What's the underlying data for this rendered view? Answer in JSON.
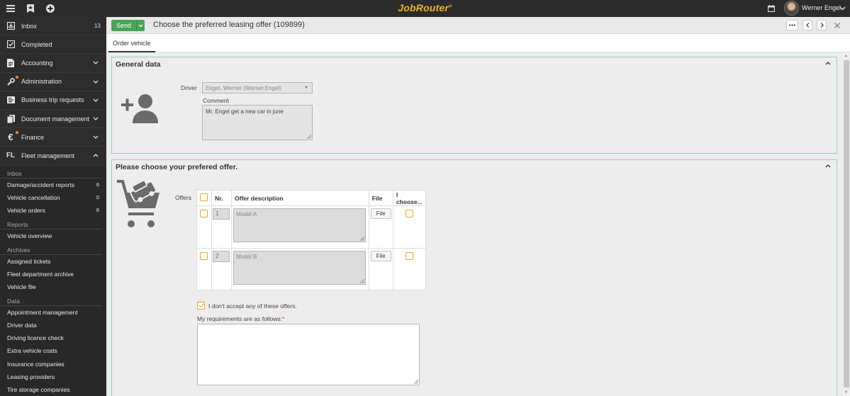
{
  "app": {
    "logo": "JobRouter",
    "logo_mark": "®"
  },
  "topbar": {
    "user_name": "Werner Engel"
  },
  "sidebar": {
    "nav": [
      {
        "label": "Inbox",
        "count": "13",
        "icon": "inbox-icon"
      },
      {
        "label": "Completed",
        "count": "",
        "icon": "check-square-icon"
      },
      {
        "label": "Accounting",
        "icon": "document-icon"
      },
      {
        "label": "Administration",
        "icon": "wrench-icon",
        "notify": true
      },
      {
        "label": "Business trip requests",
        "icon": "trip-icon"
      },
      {
        "label": "Document management",
        "icon": "files-icon"
      },
      {
        "label": "Finance",
        "icon": "euro-icon",
        "notify": true
      },
      {
        "label": "Fleet management",
        "icon": "FL"
      }
    ],
    "fleet": {
      "sections": [
        {
          "title": "Inbox",
          "items": [
            {
              "label": "Damage/accident reports",
              "count": "6"
            },
            {
              "label": "Vehicle cancellation",
              "count": "0"
            },
            {
              "label": "Vehicle orders",
              "count": "6"
            }
          ]
        },
        {
          "title": "Reports",
          "items": [
            {
              "label": "Vehicle overview"
            }
          ]
        },
        {
          "title": "Archives",
          "items": [
            {
              "label": "Assigned tickets"
            },
            {
              "label": "Fleet department archive"
            },
            {
              "label": "Vehicle file"
            }
          ]
        },
        {
          "title": "Data",
          "items": [
            {
              "label": "Appointment management"
            },
            {
              "label": "Driver data"
            },
            {
              "label": "Driving licence check"
            },
            {
              "label": "Extra vehicle costs"
            },
            {
              "label": "Insurance companies"
            },
            {
              "label": "Leasing providers"
            },
            {
              "label": "Tire storage companies"
            }
          ]
        }
      ]
    }
  },
  "header": {
    "send_label": "Send",
    "title": "Choose the preferred leasing offer (109899)"
  },
  "tabs": [
    {
      "label": "Order vehicle"
    }
  ],
  "general": {
    "title": "General data",
    "driver_label": "Driver",
    "driver_value": "Engel, Werner (Werner.Engel)",
    "comment_label": "Comment",
    "comment_value": "Mr. Engel get a new car in june"
  },
  "offers": {
    "title": "Please choose your prefered offer.",
    "label": "Offers",
    "columns": {
      "nr": "Nr.",
      "desc": "Offer description",
      "file": "File",
      "choose": "I choose..."
    },
    "rows": [
      {
        "nr": "1",
        "desc": "Model A",
        "file": "File"
      },
      {
        "nr": "2",
        "desc": "Model B",
        "file": "File"
      }
    ],
    "decline_label": "I don't accept any of these offers.",
    "requirements_label": "My requirements are as follows:",
    "required_mark": "*",
    "requirements_value": ""
  },
  "colors": {
    "accent_green": "#4aa356",
    "logo": "#f0b41c",
    "checkbox": "#e0aa1d",
    "panel_border": "#8fd0c6"
  }
}
